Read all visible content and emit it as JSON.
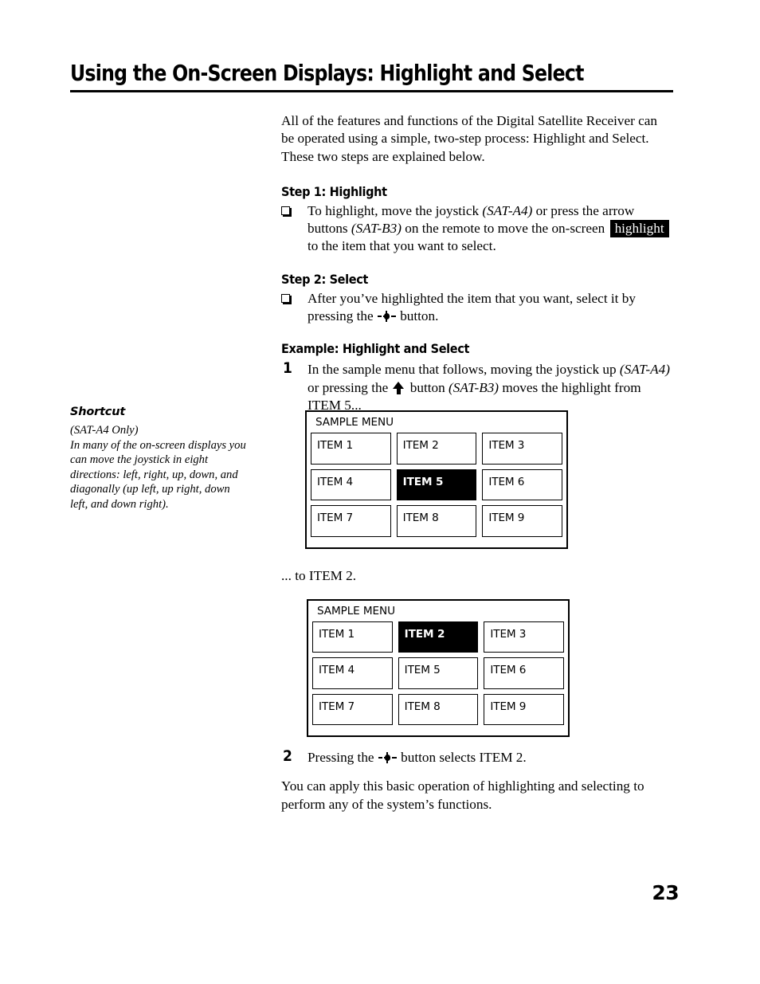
{
  "page": {
    "title": "Using the On-Screen Displays: Highlight and Select",
    "number": "23"
  },
  "intro": {
    "paragraph": "All of the features and functions of the Digital Satellite Receiver can be operated using a simple, two-step process: Highlight and Select. These two steps are explained below."
  },
  "step1": {
    "heading": "Step 1: Highlight",
    "bullet": {
      "part1": "To highlight, move the joystick ",
      "ref1": "(SAT-A4)",
      "part2": " or press the arrow buttons ",
      "ref2": "(SAT-B3)",
      "part3": " on the remote to move the on-screen ",
      "highlight_chip": "highlight",
      "part4": " to the item that you want to select."
    }
  },
  "step2": {
    "heading": "Step 2: Select",
    "bullet": {
      "part1": "After you’ve highlighted the item that you want, select it by pressing the ",
      "glyph": "select-button-glyph",
      "part2": " button."
    }
  },
  "example": {
    "heading": "Example: Highlight and Select",
    "step_1": {
      "number": "1",
      "part1": "In the sample menu that follows, moving the joystick up ",
      "ref1": "(SAT-A4)",
      "part2": " or pressing the ",
      "glyph": "up-arrow-glyph",
      "part3": " button ",
      "ref2": "(SAT-B3)",
      "part4": " moves the highlight from ITEM 5..."
    },
    "between_menus": "... to ITEM 2.",
    "step_2": {
      "number": "2",
      "part1": "Pressing the ",
      "glyph": "select-button-glyph",
      "part2": " button selects ITEM 2."
    },
    "tail_paragraph": "You can apply this basic operation of highlighting and selecting to perform any of the system’s functions."
  },
  "shortcut": {
    "title": "Shortcut",
    "subtitle": "(SAT-A4 Only)",
    "body": "In many of the on-screen displays you can move the joystick in eight directions: left, right, up, down, and diagonally (up left, up right, down left, and down right)."
  },
  "menu_1": {
    "title": "SAMPLE MENU",
    "selected_index": 4,
    "cells": [
      "ITEM 1",
      "ITEM 2",
      "ITEM 3",
      "ITEM 4",
      "ITEM 5",
      "ITEM 6",
      "ITEM 7",
      "ITEM 8",
      "ITEM 9"
    ]
  },
  "menu_2": {
    "title": "SAMPLE MENU",
    "selected_index": 1,
    "cells": [
      "ITEM 1",
      "ITEM 2",
      "ITEM 3",
      "ITEM 4",
      "ITEM 5",
      "ITEM 6",
      "ITEM 7",
      "ITEM 8",
      "ITEM 9"
    ]
  },
  "colors": {
    "highlight_background": "#000000",
    "highlight_text": "#ffffff",
    "page_background": "#ffffff",
    "text": "#000000"
  }
}
